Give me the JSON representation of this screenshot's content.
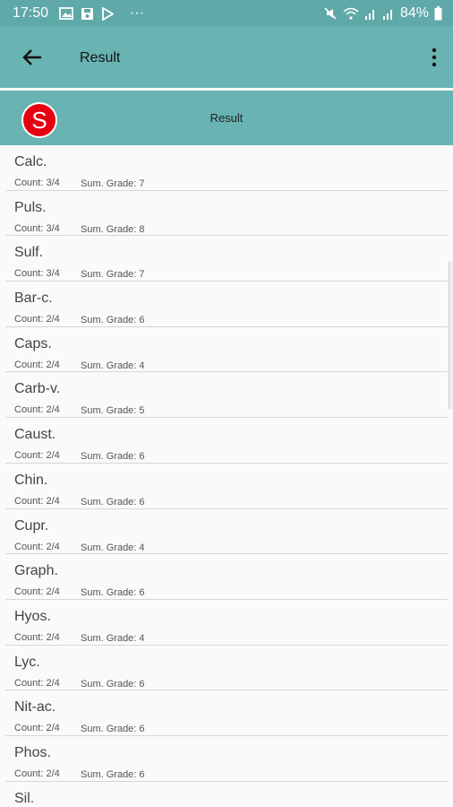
{
  "status": {
    "time": "17:50",
    "overflow": "···",
    "battery": "84%"
  },
  "app_bar": {
    "title": "Result"
  },
  "sub_header": {
    "logo_letter": "S",
    "title": "Result"
  },
  "items": [
    {
      "name": "Calc.",
      "count": "Count: 3/4",
      "grade": "Sum. Grade: 7"
    },
    {
      "name": "Puls.",
      "count": "Count: 3/4",
      "grade": "Sum. Grade: 8"
    },
    {
      "name": "Sulf.",
      "count": "Count: 3/4",
      "grade": "Sum. Grade: 7"
    },
    {
      "name": "Bar-c.",
      "count": "Count: 2/4",
      "grade": "Sum. Grade: 6"
    },
    {
      "name": "Caps.",
      "count": "Count: 2/4",
      "grade": "Sum. Grade: 4"
    },
    {
      "name": "Carb-v.",
      "count": "Count: 2/4",
      "grade": "Sum. Grade: 5"
    },
    {
      "name": "Caust.",
      "count": "Count: 2/4",
      "grade": "Sum. Grade: 6"
    },
    {
      "name": "Chin.",
      "count": "Count: 2/4",
      "grade": "Sum. Grade: 6"
    },
    {
      "name": "Cupr.",
      "count": "Count: 2/4",
      "grade": "Sum. Grade: 4"
    },
    {
      "name": "Graph.",
      "count": "Count: 2/4",
      "grade": "Sum. Grade: 6"
    },
    {
      "name": "Hyos.",
      "count": "Count: 2/4",
      "grade": "Sum. Grade: 4"
    },
    {
      "name": "Lyc.",
      "count": "Count: 2/4",
      "grade": "Sum. Grade: 6"
    },
    {
      "name": "Nit-ac.",
      "count": "Count: 2/4",
      "grade": "Sum. Grade: 6"
    },
    {
      "name": "Phos.",
      "count": "Count: 2/4",
      "grade": "Sum. Grade: 6"
    },
    {
      "name": "Sil.",
      "count": "",
      "grade": ""
    }
  ]
}
